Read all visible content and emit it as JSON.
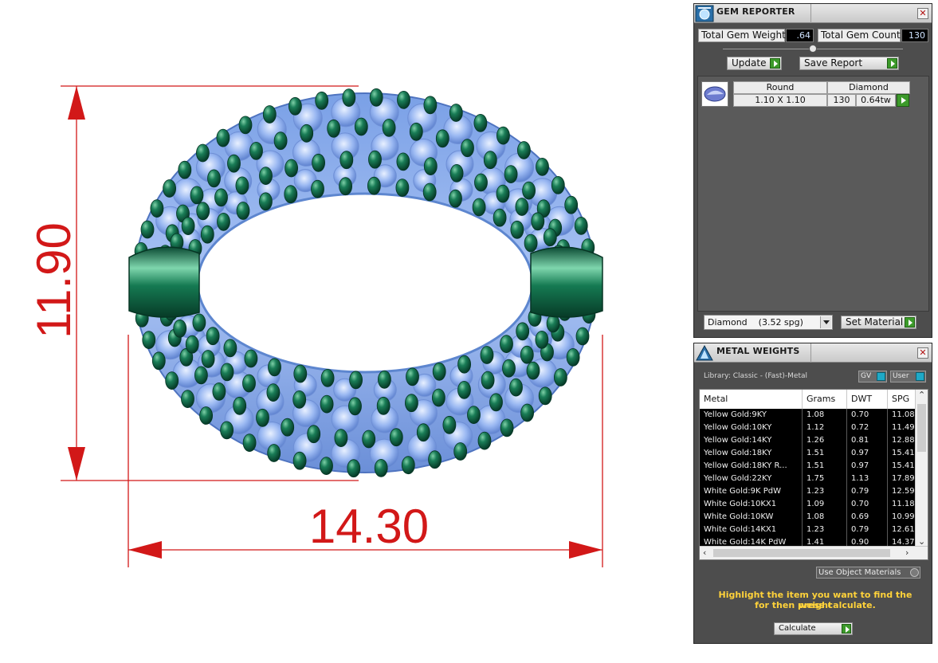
{
  "drawing": {
    "height_dimension": "11.90",
    "width_dimension": "14.30"
  },
  "gem_reporter": {
    "title": "GEM REPORTER",
    "close_glyph": "✕",
    "total_gem_weight_label": "Total Gem Weight",
    "total_gem_weight_value": ".64",
    "total_gem_count_label": "Total Gem Count",
    "total_gem_count_value": "130",
    "update_label": "Update",
    "save_report_label": "Save Report",
    "gems": [
      {
        "shape": "Round",
        "material": "Diamond",
        "size": "1.10 X 1.10",
        "count": "130",
        "weight": "0.64tw"
      }
    ],
    "material_select_value": "Diamond    (3.52 spg)",
    "set_material_label": "Set Material"
  },
  "metal_weights": {
    "title": "METAL WEIGHTS",
    "close_glyph": "✕",
    "library_label": "Library: Classic - (Fast)-Metal",
    "gv_label": "GV",
    "user_label": "User",
    "columns": [
      "Metal",
      "Grams",
      "DWT",
      "SPG"
    ],
    "rows": [
      [
        "Yellow Gold:9KY",
        "1.08",
        "0.70",
        "11.08"
      ],
      [
        "Yellow Gold:10KY",
        "1.12",
        "0.72",
        "11.49"
      ],
      [
        "Yellow Gold:14KY",
        "1.26",
        "0.81",
        "12.88"
      ],
      [
        "Yellow Gold:18KY",
        "1.51",
        "0.97",
        "15.41"
      ],
      [
        "Yellow Gold:18KY R...",
        "1.51",
        "0.97",
        "15.41"
      ],
      [
        "Yellow Gold:22KY",
        "1.75",
        "1.13",
        "17.89"
      ],
      [
        "White Gold:9K PdW",
        "1.23",
        "0.79",
        "12.59"
      ],
      [
        "White Gold:10KX1",
        "1.09",
        "0.70",
        "11.18"
      ],
      [
        "White Gold:10KW",
        "1.08",
        "0.69",
        "10.99"
      ],
      [
        "White Gold:14KX1",
        "1.23",
        "0.79",
        "12.61"
      ],
      [
        "White Gold:14K PdW",
        "1.41",
        "0.90",
        "14.37"
      ]
    ],
    "use_object_materials_label": "Use Object Materials",
    "hint_line1": "Highlight the item you want to find the weight",
    "hint_line2": "for then press calculate.",
    "calculate_label": "Calculate"
  },
  "colors": {
    "dimension": "#d21818",
    "prong": "#0f6a4a",
    "gem": "#8fb2f0",
    "panel": "#4d4d4d",
    "hint": "#ffd23a"
  }
}
